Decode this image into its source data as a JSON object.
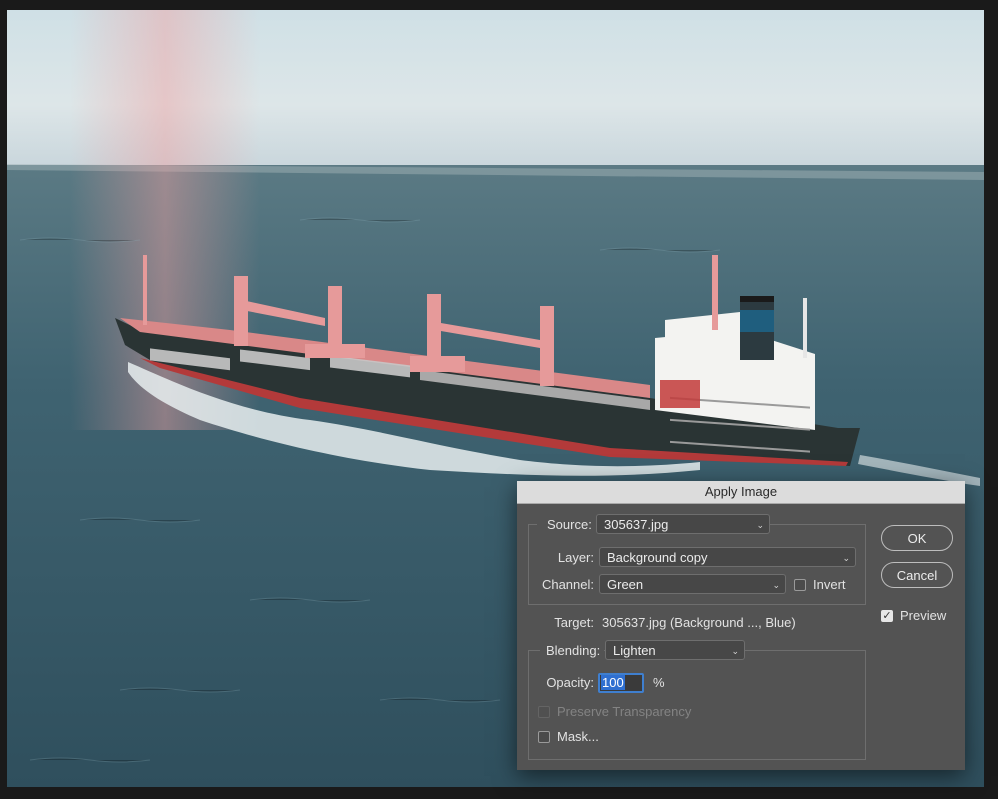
{
  "dialog": {
    "title": "Apply Image",
    "source": {
      "label": "Source:",
      "value": "305637.jpg"
    },
    "layer": {
      "label": "Layer:",
      "value": "Background copy"
    },
    "channel": {
      "label": "Channel:",
      "value": "Green"
    },
    "invert": {
      "label": "Invert",
      "checked": false
    },
    "target": {
      "label": "Target:",
      "value": "305637.jpg (Background ..., Blue)"
    },
    "blending": {
      "label": "Blending:",
      "value": "Lighten"
    },
    "opacity": {
      "label": "Opacity:",
      "value": "100",
      "unit": "%"
    },
    "preserve_transparency": {
      "label": "Preserve Transparency",
      "checked": false,
      "enabled": false
    },
    "mask": {
      "label": "Mask...",
      "checked": false
    },
    "ok_label": "OK",
    "cancel_label": "Cancel",
    "preview": {
      "label": "Preview",
      "checked": true
    }
  },
  "photo": {
    "subject": "cargo-ship",
    "colors": {
      "sky": "#d6e3e6",
      "sea": "#3d5e6b",
      "hull": "#2a3434",
      "hull_bottom": "#b33a3a",
      "cranes": "#e69a9a",
      "funnel": "#1f5e7e"
    }
  }
}
